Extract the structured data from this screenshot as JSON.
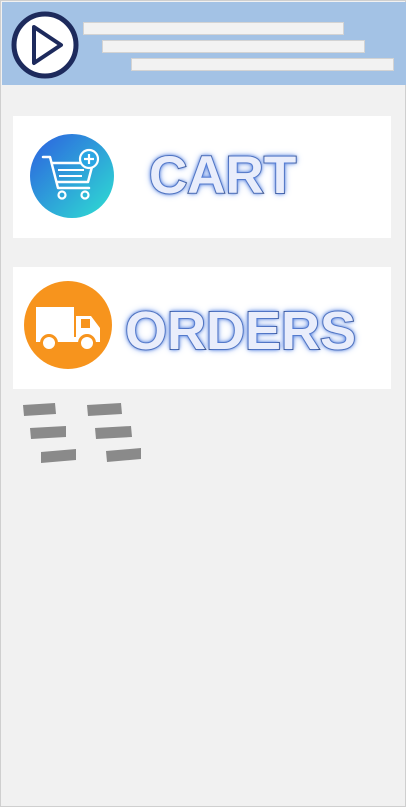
{
  "header": {
    "play_icon": "play-icon"
  },
  "menu": {
    "cart": {
      "label": "CART",
      "icon": "cart-plus-icon",
      "color_from": "#2d6fe0",
      "color_to": "#2ed3d6"
    },
    "orders": {
      "label": "ORDERS",
      "icon": "delivery-truck-icon",
      "color": "#f7941d"
    }
  },
  "loader": {
    "icon": "loading-placeholder-icon"
  },
  "colors": {
    "header_bg": "#a3c2e5",
    "page_bg": "#f1f1f1",
    "label_stroke": "#23345f"
  }
}
